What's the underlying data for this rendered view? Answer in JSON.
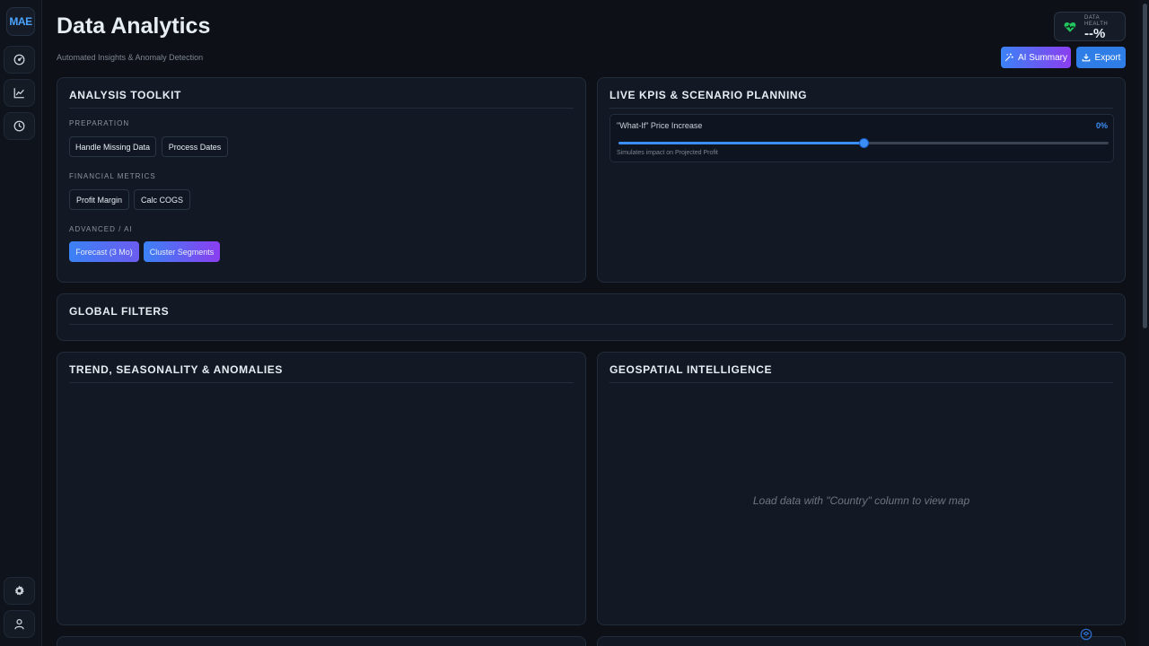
{
  "sidebar": {
    "logo": "MAE",
    "nav": [
      {
        "icon": "dashboard-icon"
      },
      {
        "icon": "line-chart-icon"
      },
      {
        "icon": "history-icon"
      }
    ],
    "bottom": [
      {
        "icon": "gear-icon"
      },
      {
        "icon": "user-icon"
      }
    ]
  },
  "header": {
    "title": "Data Analytics",
    "subtitle": "Automated Insights & Anomaly Detection",
    "health": {
      "label": "DATA HEALTH",
      "value": "--%",
      "icon": "heart-pulse-icon",
      "color": "#22c55e"
    },
    "ai_summary_label": "AI Summary",
    "export_label": "Export"
  },
  "toolkit": {
    "title": "ANALYSIS TOOLKIT",
    "sections": [
      {
        "label": "PREPARATION",
        "buttons": [
          "Handle Missing Data",
          "Process Dates"
        ]
      },
      {
        "label": "FINANCIAL METRICS",
        "buttons": [
          "Profit Margin",
          "Calc COGS"
        ]
      },
      {
        "label": "ADVANCED / AI",
        "buttons": [
          "Forecast (3 Mo)",
          "Cluster Segments"
        ]
      }
    ]
  },
  "kpis": {
    "title": "LIVE KPIS & SCENARIO PLANNING",
    "scenario": {
      "label": "\"What-If\" Price Increase",
      "value": "0%",
      "slider_position": 0.5,
      "hint": "Simulates impact on Projected Profit"
    }
  },
  "filters": {
    "title": "GLOBAL FILTERS"
  },
  "trend": {
    "title": "TREND, SEASONALITY & ANOMALIES"
  },
  "geo": {
    "title": "GEOSPATIAL INTELLIGENCE",
    "placeholder": "Load data with \"Country\" column to view map"
  },
  "colors": {
    "accent": "#3b82f6",
    "accent2": "#8b3ef0",
    "background": "#0d1117",
    "panel": "#121824"
  }
}
